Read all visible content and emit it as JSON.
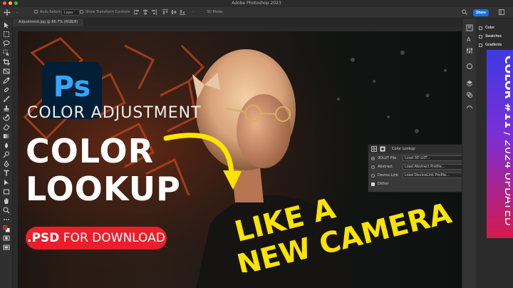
{
  "window": {
    "title": "Adobe Photoshop 2023"
  },
  "options_bar": {
    "auto_select_label": "Auto-Select:",
    "auto_select_value": "Layer",
    "transform_controls_label": "Show Transform Controls",
    "mode_3d_label": "3D Mode:",
    "share_label": "Share"
  },
  "document": {
    "tab_label": "Adjustment.jpg @ 66.7% (RGB/8)"
  },
  "panels": {
    "items": [
      "Color",
      "Swatches",
      "Gradients"
    ]
  },
  "overlay": {
    "logo_text": "Ps",
    "kicker": "COLOR ADJUSTMENT",
    "headline_line1": "COLOR",
    "headline_line2": "LOOKUP",
    "download_prefix": ".PSD",
    "download_suffix": " FOR DOWNLOAD",
    "camera_line1": "LIKE A",
    "camera_line2": "NEW CAMERA"
  },
  "banner": {
    "series": "COLOR #11",
    "separator": " / ",
    "update": "2024 UPDATED"
  },
  "color_lookup_panel": {
    "title": "Color Lookup",
    "rows": [
      {
        "label": "3DLUT File",
        "value": "Load 3D LUT...",
        "selected": true
      },
      {
        "label": "Abstract",
        "value": "Load Abstract Profile...",
        "selected": false
      },
      {
        "label": "Device Link",
        "value": "Load DeviceLink Profile...",
        "selected": false
      }
    ],
    "dither_label": "Dither"
  },
  "colors": {
    "ps_logo_bg": "#001e36",
    "ps_logo_fg": "#31a8ff",
    "share_button": "#1473e6",
    "download_pill": "#ec1e2b",
    "camera_text": "#fce300",
    "banner_top": "#3f39e0",
    "banner_bottom": "#d41a4d"
  }
}
